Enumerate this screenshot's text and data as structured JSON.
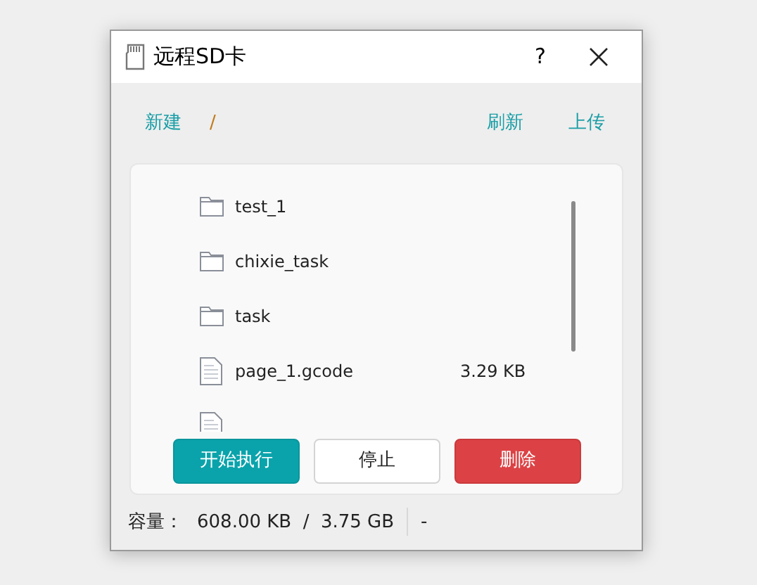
{
  "window": {
    "title": "远程SD卡",
    "help": "?"
  },
  "toolbar": {
    "new": "新建",
    "path": "/",
    "refresh": "刷新",
    "upload": "上传"
  },
  "files": [
    {
      "kind": "folder",
      "name": "test_1"
    },
    {
      "kind": "folder",
      "name": "chixie_task"
    },
    {
      "kind": "folder",
      "name": "task"
    },
    {
      "kind": "file",
      "name": "page_1.gcode",
      "size": "3.29 KB"
    },
    {
      "kind": "file"
    }
  ],
  "buttons": [
    {
      "kind": "primary",
      "label": "开始执行"
    },
    {
      "kind": "default",
      "label": "停止"
    },
    {
      "kind": "danger",
      "label": "删除"
    }
  ],
  "status_bar": {
    "label": "容量：",
    "capacity": "608.00 KB  /  3.75 GB",
    "status": "-"
  }
}
